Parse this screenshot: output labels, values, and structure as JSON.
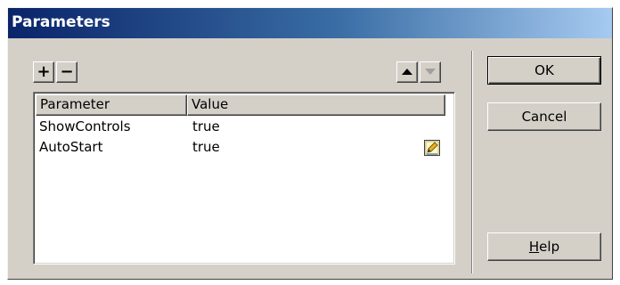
{
  "dialog": {
    "title": "Parameters"
  },
  "toolbar": {
    "add_label": "+",
    "remove_label": "−",
    "move_up_icon": "triangle-up-icon",
    "move_down_icon": "triangle-down-icon"
  },
  "table": {
    "columns": [
      "Parameter",
      "Value"
    ],
    "rows": [
      {
        "parameter": "ShowControls",
        "value": "true"
      },
      {
        "parameter": "AutoStart",
        "value": "true"
      }
    ]
  },
  "buttons": {
    "ok_label": "OK",
    "cancel_label": "Cancel",
    "help_mnemonic": "H",
    "help_rest": "elp"
  },
  "colors": {
    "title_gradient_start": "#0a246a",
    "title_gradient_end": "#a6caf0",
    "face": "#d4d0c8"
  }
}
